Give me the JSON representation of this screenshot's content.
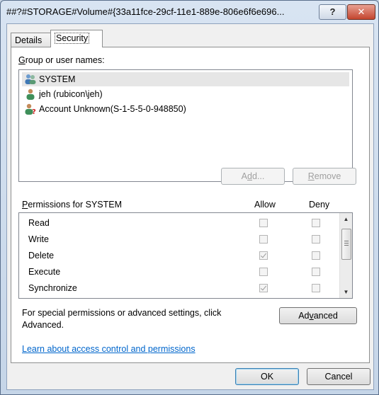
{
  "window": {
    "title": "##?#STORAGE#Volume#{33a11fce-29cf-11e1-889e-806e6f6e696...",
    "help_label": "?",
    "close_label": "✕"
  },
  "tabs": [
    {
      "label": "Details"
    },
    {
      "label": "Security"
    }
  ],
  "groups": {
    "label_prefix": "G",
    "label_rest": "roup or user names:",
    "users": [
      {
        "name": "SYSTEM",
        "icon": "group-users-icon"
      },
      {
        "name": "jeh (rubicon\\jeh)",
        "icon": "user-icon"
      },
      {
        "name": "Account Unknown(S-1-5-5-0-948850)",
        "icon": "unknown-user-icon"
      }
    ],
    "add_prefix": "A",
    "add_u": "d",
    "add_rest": "d...",
    "remove_prefix": "",
    "remove_u": "R",
    "remove_rest": "emove"
  },
  "permissions": {
    "label_u": "P",
    "label_rest": "ermissions for SYSTEM",
    "allow_header": "Allow",
    "deny_header": "Deny",
    "rows": [
      {
        "name": "Read",
        "allow": false,
        "deny": false
      },
      {
        "name": "Write",
        "allow": false,
        "deny": false
      },
      {
        "name": "Delete",
        "allow": true,
        "deny": false
      },
      {
        "name": "Execute",
        "allow": false,
        "deny": false
      },
      {
        "name": "Synchronize",
        "allow": true,
        "deny": false
      }
    ]
  },
  "special": {
    "line1": "For special permissions or advanced settings, click",
    "line2": "Advanced.",
    "advanced_prefix": "Ad",
    "advanced_u": "v",
    "advanced_rest": "anced"
  },
  "link_text": "Learn about access control and permissions",
  "footer": {
    "ok_label": "OK",
    "cancel_label": "Cancel"
  }
}
